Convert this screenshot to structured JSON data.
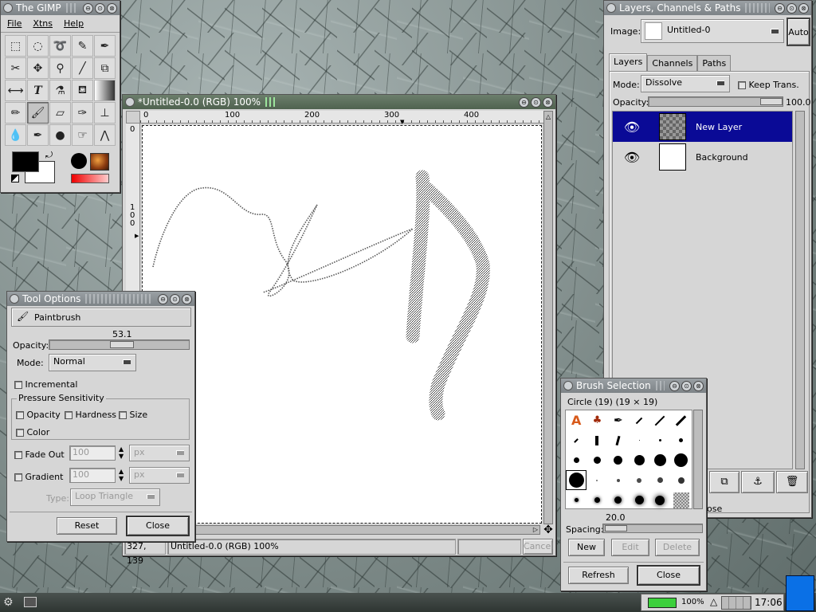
{
  "toolbox": {
    "title": "The GIMP",
    "menu": [
      "File",
      "Xtns",
      "Help"
    ],
    "tools": [
      "rect-select",
      "ellipse-select",
      "free-select",
      "fuzzy-select",
      "bezier-select",
      "intelligent-scissors",
      "move",
      "magnify",
      "crop",
      "transform",
      "flip",
      "text",
      "color-picker",
      "bucket-fill",
      "blend",
      "pencil",
      "paintbrush",
      "eraser",
      "airbrush",
      "clone",
      "convolve",
      "ink",
      "dodge-burn",
      "smudge",
      "measure"
    ]
  },
  "image_window": {
    "title": "*Untitled-0.0 (RGB) 100%",
    "ruler_labels": [
      "0",
      "100",
      "200",
      "300",
      "400"
    ],
    "vruler_labels": [
      "0",
      "1",
      "0",
      "0"
    ],
    "status_coords": "327, 139",
    "status_title": "Untitled-0.0 (RGB) 100%",
    "cancel": "Cancel"
  },
  "tool_options": {
    "title": "Tool Options",
    "tool_name": "Paintbrush",
    "opacity_label": "Opacity:",
    "opacity_value": "53.1",
    "mode_label": "Mode:",
    "mode_value": "Normal",
    "incremental": "Incremental",
    "pressure_group": "Pressure Sensitivity",
    "pressure_opacity": "Opacity",
    "pressure_hardness": "Hardness",
    "pressure_size": "Size",
    "pressure_color": "Color",
    "fade_out": "Fade Out",
    "fade_value": "100",
    "fade_unit": "px",
    "gradient": "Gradient",
    "gradient_value": "100",
    "gradient_unit": "px",
    "type_label": "Type:",
    "type_value": "Loop Triangle",
    "reset": "Reset",
    "close": "Close"
  },
  "layers": {
    "title": "Layers, Channels & Paths",
    "image_label": "Image:",
    "image_value": "Untitled-0",
    "auto": "Auto",
    "tabs": [
      "Layers",
      "Channels",
      "Paths"
    ],
    "mode_label": "Mode:",
    "mode_value": "Dissolve",
    "keep_trans": "Keep Trans.",
    "opacity_label": "Opacity:",
    "opacity_value": "100.0",
    "items": [
      {
        "name": "New Layer",
        "selected": true
      },
      {
        "name": "Background",
        "selected": false
      }
    ],
    "close_fragment": "ose"
  },
  "brushes": {
    "title": "Brush Selection",
    "brush_name": "Circle (19)  (19 × 19)",
    "spacing_label": "Spacing:",
    "spacing_value": "20.0",
    "new": "New",
    "edit": "Edit",
    "delete": "Delete",
    "refresh": "Refresh",
    "close": "Close"
  },
  "taskbar": {
    "zoom": "100%",
    "clock": "17:06"
  },
  "colors": {
    "selection": "#0a0a96",
    "titlebar": "#8a9094",
    "titlebar_active": "#5a6e5a",
    "window_bg": "#d6d6d6"
  }
}
